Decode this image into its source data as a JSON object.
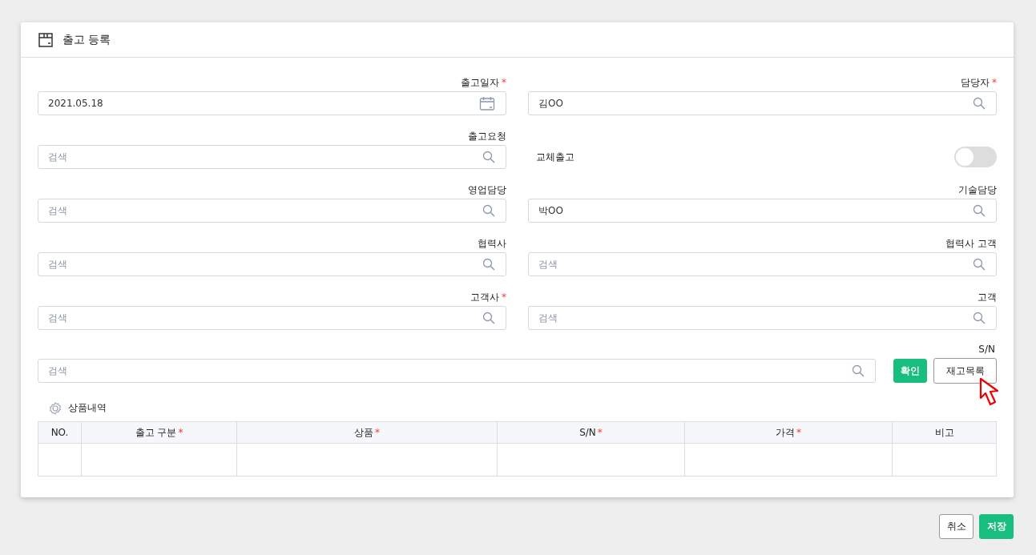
{
  "title": "출고 등록",
  "form": [
    {
      "label": "출고일자",
      "required_mark": "*",
      "kind": "date",
      "value": "2021.05.18"
    },
    {
      "label": "담당자",
      "required_mark": "*",
      "kind": "search",
      "value": "김OO"
    },
    {
      "label": "출고요청",
      "kind": "search",
      "placeholder": "검색"
    },
    {
      "label": "교체출고",
      "kind": "toggle",
      "on": false
    },
    {
      "label": "영업담당",
      "kind": "search",
      "placeholder": "검색"
    },
    {
      "label": "기술담당",
      "kind": "search",
      "value": "박OO"
    },
    {
      "label": "협력사",
      "kind": "search",
      "placeholder": "검색"
    },
    {
      "label": "협력사 고객",
      "kind": "search",
      "placeholder": "검색"
    },
    {
      "label": "고객사",
      "required_mark": "*",
      "kind": "search",
      "placeholder": "검색"
    },
    {
      "label": "고객",
      "kind": "search",
      "placeholder": "검색"
    }
  ],
  "sn": {
    "label": "S/N",
    "placeholder": "검색",
    "confirm": "확인",
    "stock": "재고목록"
  },
  "section_title": "상품내역",
  "table": {
    "columns": [
      {
        "label": "NO."
      },
      {
        "label": "출고 구분",
        "required_mark": "*"
      },
      {
        "label": "상품",
        "required_mark": "*"
      },
      {
        "label": "S/N",
        "required_mark": "*"
      },
      {
        "label": "가격",
        "required_mark": "*"
      },
      {
        "label": "비고"
      }
    ]
  },
  "footer": [
    {
      "label": "취소",
      "kind": "secondary"
    },
    {
      "label": "저장",
      "kind": "primary"
    }
  ]
}
